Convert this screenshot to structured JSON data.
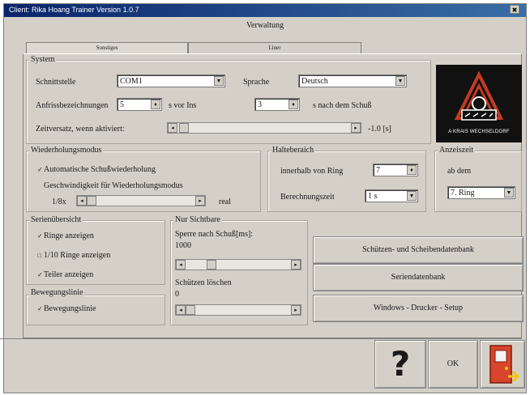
{
  "window": {
    "title": "Client: Rika Hoang Trainer Version 1.0.7",
    "close_glyph": "✖",
    "subtitle": "Verwaltung"
  },
  "tabs": [
    {
      "label": "Sonstiges",
      "active": true
    },
    {
      "label": "Liner",
      "active": false
    }
  ],
  "system": {
    "group_label": "System",
    "port_label": "Schnittstelle",
    "port_value": "COM1",
    "language_label": "Sprache",
    "language_value": "Deutsch",
    "display_label": "Anfrissbezeichnungen",
    "display_before_value": "5",
    "display_before_suffix": "s vor Ins",
    "display_after_value": "3",
    "display_after_suffix": "s nach dem Schuß",
    "delay_label": "Zeitversatz, wenn aktiviert:",
    "delay_value": "-1.0 [s]"
  },
  "repeat": {
    "group_label": "Wiederholungsmodus",
    "auto_label": "Automatische Schußwiederholung",
    "speed_label": "Geschwindigkeit für Wiederholungsmodus",
    "speed_min": "1/8x",
    "speed_max": "real"
  },
  "hit_area": {
    "group_label": "Halteberaich",
    "inside_label": "innerhalb von Ring",
    "inside_value": "7",
    "time_label": "Berechnungszeit",
    "time_value": "1 s"
  },
  "display": {
    "group_label": "Anzeiszeit",
    "from_label": "ab dem",
    "from_value": "7. Ring"
  },
  "series": {
    "group_label": "Serienübersicht",
    "rings_label": "Ringe anzeigen",
    "tenth_label": "1/10 Ringe anzeigen",
    "partial_label": "Teiler anzeigen"
  },
  "motion": {
    "group_label": "Bewegungslinie",
    "motion_label": "Bewegungslinie"
  },
  "simulation": {
    "group_label": "Nur Sichtbare",
    "lock_label": "Sperre nach Schuß[ms]:",
    "lock_value": "1000",
    "shooter_label": "Schützen löschen",
    "shooter_value": "0"
  },
  "buttons": {
    "shooters_db": "Schützen- und Scheibendatenbank",
    "series_db": "Seriendatenbank",
    "windows_setup": "Windows - Drucker - Setup",
    "help_glyph": "?",
    "ok": "OK"
  },
  "logo": {
    "caption": "A KRAIS WECHSELDORF"
  }
}
